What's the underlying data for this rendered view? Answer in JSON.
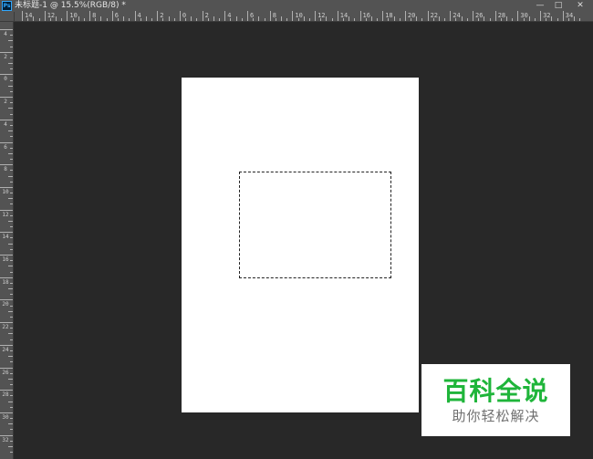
{
  "app": {
    "icon_label": "Ps"
  },
  "document": {
    "title": "未标题-1 @ 15.5%(RGB/8) *"
  },
  "window_controls": {
    "minimize": "—",
    "restore": "□",
    "close": "✕"
  },
  "ruler": {
    "horizontal": [
      "14",
      "12",
      "10",
      "8",
      "6",
      "4",
      "2",
      "0",
      "2",
      "4",
      "6",
      "8",
      "10",
      "12",
      "14",
      "16",
      "18",
      "20",
      "22",
      "24",
      "26",
      "28",
      "30",
      "32",
      "34"
    ],
    "vertical": [
      "4",
      "2",
      "0",
      "2",
      "4",
      "6",
      "8",
      "10",
      "12",
      "14",
      "16",
      "18",
      "20",
      "22",
      "24",
      "26",
      "28",
      "30",
      "32"
    ]
  },
  "watermark": {
    "title": "百科全说",
    "subtitle": "助你轻松解决"
  },
  "colors": {
    "workspace": "#282828",
    "ruler": "#535353",
    "canvas": "#ffffff",
    "watermark_green": "#1fb53a"
  }
}
